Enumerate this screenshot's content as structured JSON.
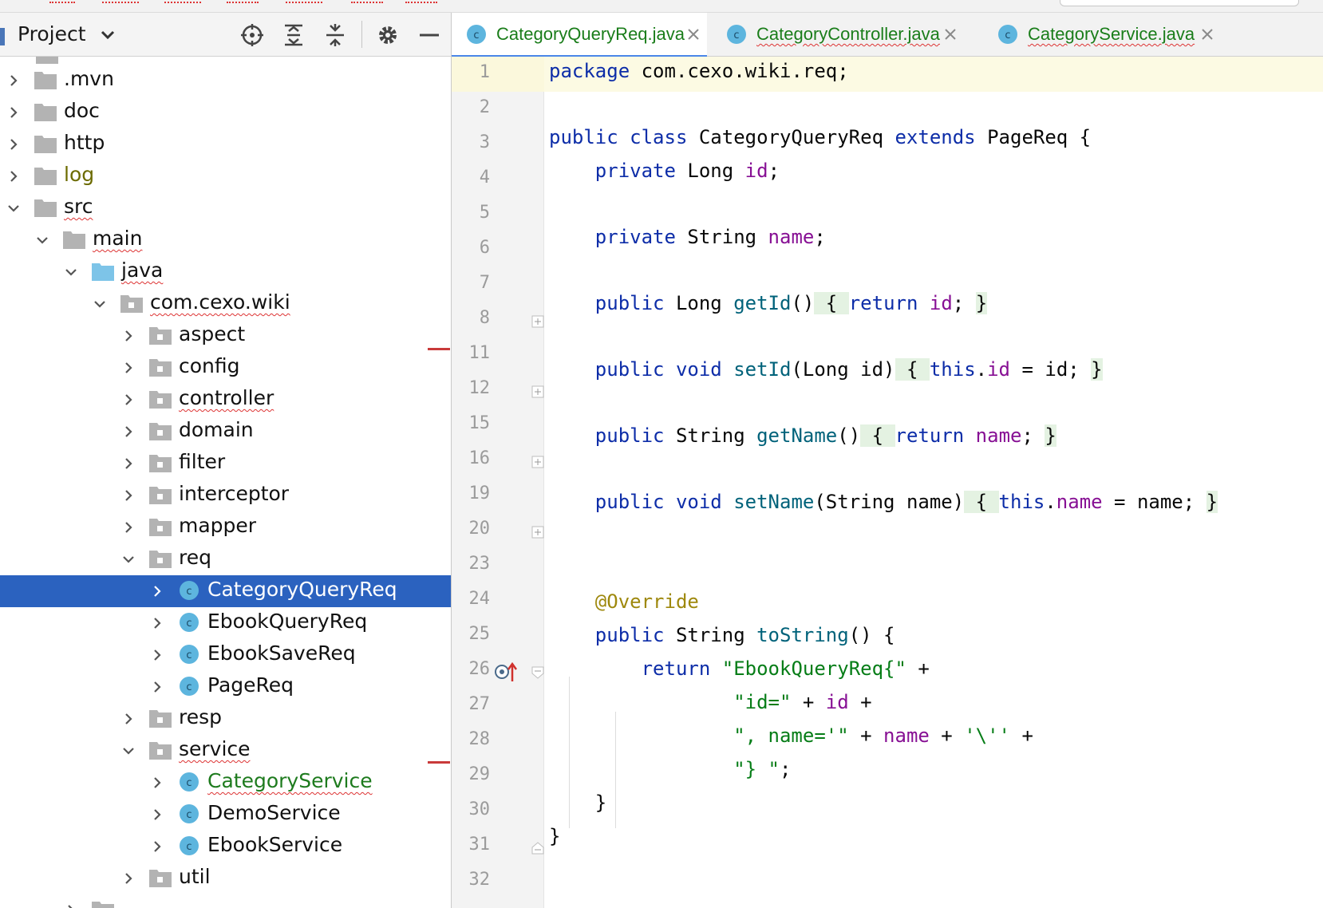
{
  "colors": {
    "keyword": "#0d2da8",
    "field": "#871094",
    "method": "#00627a",
    "string": "#067d17",
    "annotation": "#9e880d",
    "selection": "#2b62bf",
    "folder": "#b3b3b3",
    "source_folder": "#7dc4e8",
    "class_icon": "#5db5de"
  },
  "project_panel": {
    "title": "Project",
    "toolbar_icons": [
      "locate-icon",
      "expand-all-icon",
      "collapse-all-icon",
      "gear-icon",
      "hide-icon"
    ],
    "tree": [
      {
        "label": ".mvn",
        "icon": "folder-icon",
        "expanded": false
      },
      {
        "label": "doc",
        "icon": "folder-icon",
        "expanded": false
      },
      {
        "label": "http",
        "icon": "folder-icon",
        "expanded": false
      },
      {
        "label": "log",
        "icon": "folder-icon",
        "expanded": false
      },
      {
        "label": "src",
        "icon": "folder-icon",
        "expanded": true
      },
      {
        "label": "main",
        "icon": "folder-icon",
        "expanded": true
      },
      {
        "label": "java",
        "icon": "source-folder-icon",
        "expanded": true
      },
      {
        "label": "com.cexo.wiki",
        "icon": "package-icon",
        "expanded": true
      },
      {
        "label": "aspect",
        "icon": "package-icon",
        "expanded": false
      },
      {
        "label": "config",
        "icon": "package-icon",
        "expanded": false
      },
      {
        "label": "controller",
        "icon": "package-icon",
        "expanded": false
      },
      {
        "label": "domain",
        "icon": "package-icon",
        "expanded": false
      },
      {
        "label": "filter",
        "icon": "package-icon",
        "expanded": false
      },
      {
        "label": "interceptor",
        "icon": "package-icon",
        "expanded": false
      },
      {
        "label": "mapper",
        "icon": "package-icon",
        "expanded": false
      },
      {
        "label": "req",
        "icon": "package-icon",
        "expanded": true
      },
      {
        "label": "CategoryQueryReq",
        "icon": "class-icon",
        "expanded": false,
        "selected": true
      },
      {
        "label": "EbookQueryReq",
        "icon": "class-icon",
        "expanded": false
      },
      {
        "label": "EbookSaveReq",
        "icon": "class-icon",
        "expanded": false
      },
      {
        "label": "PageReq",
        "icon": "class-icon",
        "expanded": false
      },
      {
        "label": "resp",
        "icon": "package-icon",
        "expanded": false
      },
      {
        "label": "service",
        "icon": "package-icon",
        "expanded": true
      },
      {
        "label": "CategoryService",
        "icon": "class-icon",
        "expanded": false
      },
      {
        "label": "DemoService",
        "icon": "class-icon",
        "expanded": false
      },
      {
        "label": "EbookService",
        "icon": "class-icon",
        "expanded": false
      },
      {
        "label": "util",
        "icon": "package-icon",
        "expanded": false
      }
    ]
  },
  "editor": {
    "tabs": [
      {
        "label": "CategoryQueryReq.java",
        "active": true
      },
      {
        "label": "CategoryController.java",
        "active": false
      },
      {
        "label": "CategoryService.java",
        "active": false
      }
    ],
    "line_numbers": [
      "1",
      "2",
      "3",
      "4",
      "5",
      "6",
      "7",
      "8",
      "11",
      "12",
      "15",
      "16",
      "19",
      "20",
      "23",
      "24",
      "25",
      "26",
      "27",
      "28",
      "29",
      "30",
      "31",
      "32"
    ],
    "code": {
      "l1_kw": "package",
      "l1_rest": " com.cexo.wiki.req;",
      "l3_kw1": "public class",
      "l3_name": " CategoryQueryReq ",
      "l3_kw2": "extends",
      "l3_rest": " PageReq {",
      "l4_kw": "private",
      "l4_type": " Long ",
      "l4_field": "id",
      "l4_end": ";",
      "l6_kw": "private",
      "l6_type": " String ",
      "l6_field": "name",
      "l6_end": ";",
      "l8_kw": "public",
      "l8_type": " Long ",
      "l8_method": "getId",
      "l8_parens": "()",
      "l8_open": " { ",
      "l8_ret": "return",
      "l8_field": " id",
      "l8_semi": "; ",
      "l8_close": "}",
      "l12_kw": "public void",
      "l12_method": " setId",
      "l12_params": "(Long id)",
      "l12_open": " { ",
      "l12_this": "this",
      "l12_dot": ".",
      "l12_field": "id",
      "l12_assign": " = id; ",
      "l12_close": "}",
      "l16_kw": "public",
      "l16_type": " String ",
      "l16_method": "getName",
      "l16_parens": "()",
      "l16_open": " { ",
      "l16_ret": "return",
      "l16_field": " name",
      "l16_semi": "; ",
      "l16_close": "}",
      "l20_kw": "public void",
      "l20_method": " setName",
      "l20_params": "(String name)",
      "l20_open": " { ",
      "l20_this": "this",
      "l20_dot": ".",
      "l20_field": "name",
      "l20_assign": " = name; ",
      "l20_close": "}",
      "l25_ann": "@Override",
      "l26_kw": "public",
      "l26_type": " String ",
      "l26_method": "toString",
      "l26_rest": "() {",
      "l27_kw": "return",
      "l27_str": " \"EbookQueryReq{\"",
      "l27_rest": " +",
      "l28_str": "\"id=\"",
      "l28_op": " + ",
      "l28_field": "id",
      "l28_rest": " +",
      "l29_str1": "\", name='\"",
      "l29_op1": " + ",
      "l29_field": "name",
      "l29_op2": " + ",
      "l29_str2": "'\\''",
      "l29_rest": " +",
      "l30_str": "\"} \"",
      "l30_rest": ";",
      "l31": "}",
      "l32": "}"
    }
  }
}
